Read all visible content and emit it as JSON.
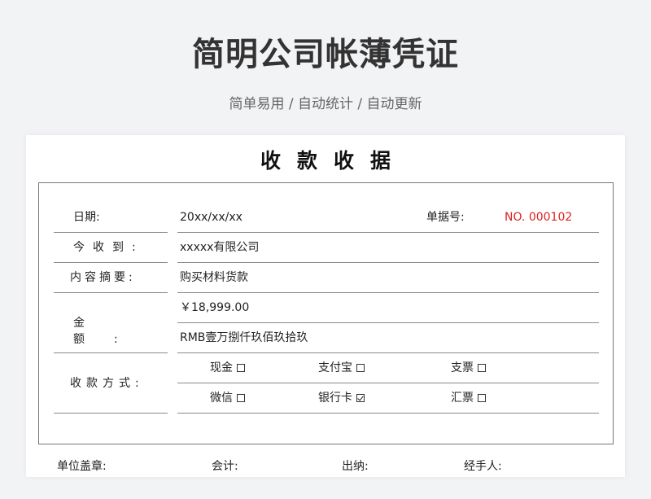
{
  "header": {
    "title": "简明公司帐薄凭证",
    "subtitle": "简单易用 / 自动统计 / 自动更新"
  },
  "receipt": {
    "title": "收款收据",
    "rows": {
      "date_label": "日期:",
      "date_value": "20xx/xx/xx",
      "number_label": "单据号:",
      "number_value": "NO. 000102",
      "received_from_label": "今收到:",
      "received_from_value": "xxxxx有限公司",
      "summary_label": "内容摘要:",
      "summary_value": "购买材料货款",
      "amount_label": "金额:",
      "amount_value": "￥18,999.00",
      "amount_words": "RMB壹万捌仟玖佰玖拾玖",
      "payment_label": "收款方式:"
    },
    "payment_methods": [
      {
        "label": "现金",
        "checked": false
      },
      {
        "label": "支付宝",
        "checked": false
      },
      {
        "label": "支票",
        "checked": false
      },
      {
        "label": "微信",
        "checked": false
      },
      {
        "label": "银行卡",
        "checked": true
      },
      {
        "label": "汇票",
        "checked": false
      }
    ],
    "footer": [
      "单位盖章:",
      "会计:",
      "出纳:",
      "经手人:"
    ]
  },
  "colors": {
    "number_accent": "#e02020",
    "frame": "#777777",
    "background": "#f2f3f5"
  }
}
